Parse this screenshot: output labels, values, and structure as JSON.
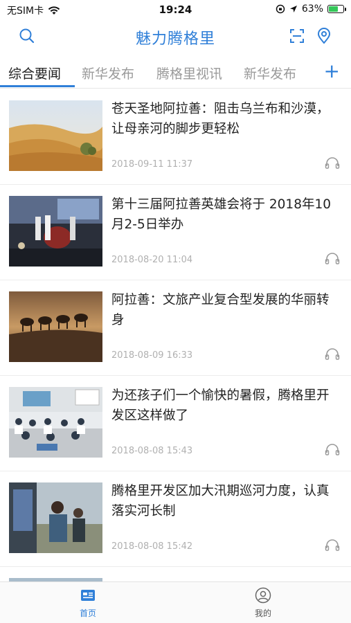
{
  "status_bar": {
    "carrier": "无SIM卡",
    "time": "19:24",
    "battery_percent": "63%",
    "battery_level": 0.63
  },
  "header": {
    "title": "魅力腾格里",
    "icons": [
      "search-icon",
      "scan-icon",
      "location-pin-icon"
    ]
  },
  "tabs": [
    {
      "label": "综合要闻",
      "active": true
    },
    {
      "label": "新华发布",
      "active": false
    },
    {
      "label": "腾格里视讯",
      "active": false
    },
    {
      "label": "新华发布",
      "active": false
    }
  ],
  "tabs_add_label": "+",
  "news": [
    {
      "title": "苍天圣地阿拉善：阻击乌兰布和沙漠，让母亲河的脚步更轻松",
      "date": "2018-09-11 11:37",
      "image": "desert-dunes"
    },
    {
      "title": "第十三届阿拉善英雄会将于 2018年10月2-5日举办",
      "date": "2018-08-20 11:04",
      "image": "stage-event"
    },
    {
      "title": "阿拉善：文旅产业复合型发展的华丽转身",
      "date": "2018-08-09 16:33",
      "image": "camel-caravan"
    },
    {
      "title": "为还孩子们一个愉快的暑假，腾格里开发区这样做了",
      "date": "2018-08-08 15:43",
      "image": "classroom"
    },
    {
      "title": "腾格里开发区加大汛期巡河力度，认真落实河长制",
      "date": "2018-08-08 15:42",
      "image": "river-patrol"
    }
  ],
  "bottom_nav": [
    {
      "label": "首页",
      "icon": "home-news-icon",
      "active": true
    },
    {
      "label": "我的",
      "icon": "profile-icon",
      "active": false
    }
  ],
  "colors": {
    "accent": "#2f7fd8",
    "inactive_tab": "#9a9a9a",
    "date_text": "#b0b0b0"
  }
}
